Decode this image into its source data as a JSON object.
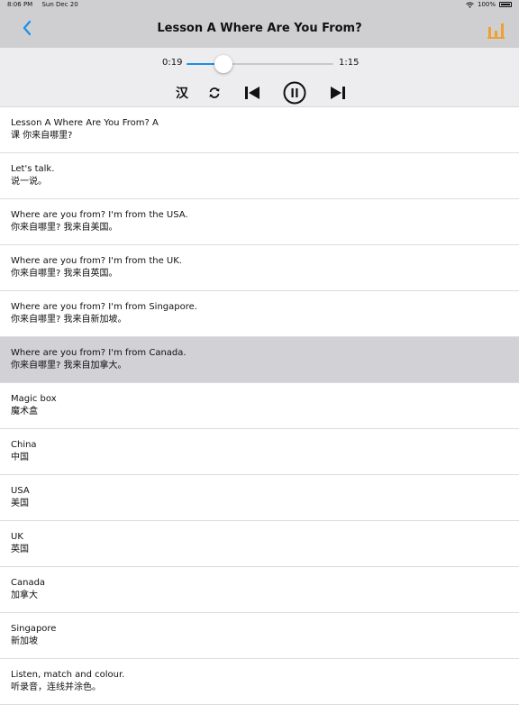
{
  "status": {
    "time": "8:06 PM",
    "date": "Sun Dec 20",
    "battery": "100%"
  },
  "nav": {
    "title": "Lesson A Where Are You From?"
  },
  "player": {
    "elapsed": "0:19",
    "total": "1:15",
    "progress": 0.253,
    "lang_label": "汉"
  },
  "colors": {
    "accent": "#1d8fe6",
    "chart_icon": "#f0a030",
    "selected_row": "#d1d1d6"
  },
  "icons": {
    "back": "chevron-left-icon",
    "chart": "bar-chart-icon",
    "repeat": "repeat-icon",
    "prev": "skip-previous-icon",
    "pause": "pause-icon",
    "next": "skip-next-icon"
  },
  "lessons": [
    {
      "en": "Lesson A Where Are You From? A",
      "zh": "课 你来自哪里?",
      "selected": false
    },
    {
      "en": "Let's talk.",
      "zh": "说一说。",
      "selected": false
    },
    {
      "en": "Where are you from? I'm from the USA.",
      "zh": "你来自哪里? 我来自美国。",
      "selected": false
    },
    {
      "en": "Where are you from? I'm from the UK.",
      "zh": "你来自哪里? 我来自英国。",
      "selected": false
    },
    {
      "en": "Where are you from? I'm from Singapore.",
      "zh": "你来自哪里? 我来自新加坡。",
      "selected": false
    },
    {
      "en": "Where are you from? I'm from Canada.",
      "zh": "你来自哪里? 我来自加拿大。",
      "selected": true
    },
    {
      "en": "Magic box",
      "zh": "魔术盒",
      "selected": false
    },
    {
      "en": "China",
      "zh": "中国",
      "selected": false
    },
    {
      "en": "USA",
      "zh": "美国",
      "selected": false
    },
    {
      "en": "UK",
      "zh": "英国",
      "selected": false
    },
    {
      "en": "Canada",
      "zh": "加拿大",
      "selected": false
    },
    {
      "en": "Singapore",
      "zh": "新加坡",
      "selected": false
    },
    {
      "en": "Listen, match and colour.",
      "zh": "听录音，连线并涂色。",
      "selected": false
    }
  ]
}
